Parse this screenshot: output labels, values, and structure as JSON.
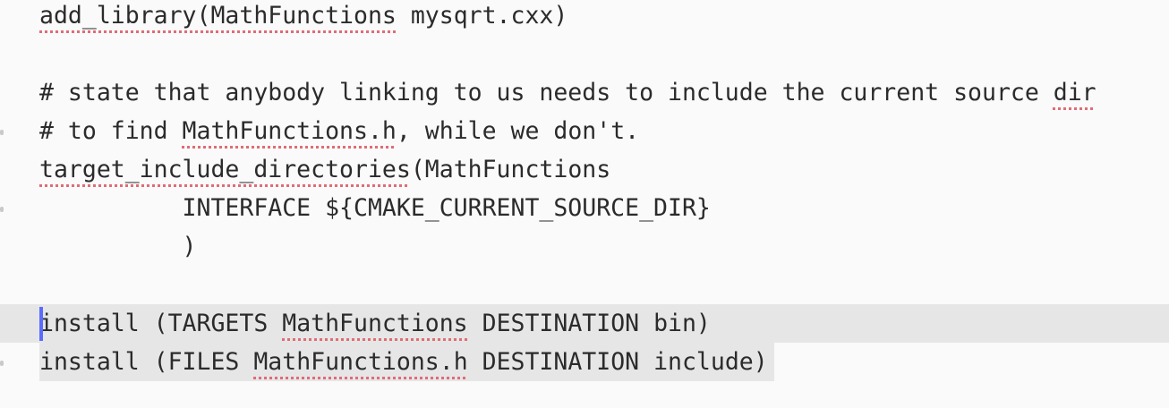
{
  "editor": {
    "lines": [
      {
        "parts": [
          "add_library(",
          "MathFunctions",
          " mysqrt.cxx)"
        ],
        "spell": [
          true,
          true,
          false
        ],
        "split_first": [
          "add_library",
          "("
        ]
      },
      {
        "text": ""
      },
      {
        "parts": [
          "# state that anybody linking to us needs to include the current source ",
          "dir"
        ],
        "spell": [
          false,
          true
        ]
      },
      {
        "parts": [
          "# to find ",
          "MathFunctions.h",
          ", while we don't."
        ],
        "spell": [
          false,
          true,
          false
        ]
      },
      {
        "parts": [
          "target_include_directories",
          "(MathFunctions"
        ],
        "spell": [
          true,
          false
        ]
      },
      {
        "text": "          INTERFACE ${CMAKE_CURRENT_SOURCE_DIR}"
      },
      {
        "text": "          )"
      },
      {
        "text": ""
      },
      {
        "parts": [
          "install (TARGETS ",
          "MathFunctions",
          " DESTINATION bin)"
        ],
        "spell": [
          false,
          true,
          false
        ]
      },
      {
        "parts": [
          "install (FILES ",
          "MathFunctions.h",
          " DESTINATION include)"
        ],
        "spell": [
          false,
          true,
          false
        ]
      }
    ]
  },
  "colors": {
    "background": "#fafafa",
    "current_line": "#e6e6e6",
    "caret": "#5b6bff",
    "spell_underline": "#e06c75",
    "text": "#2b2b2b"
  }
}
